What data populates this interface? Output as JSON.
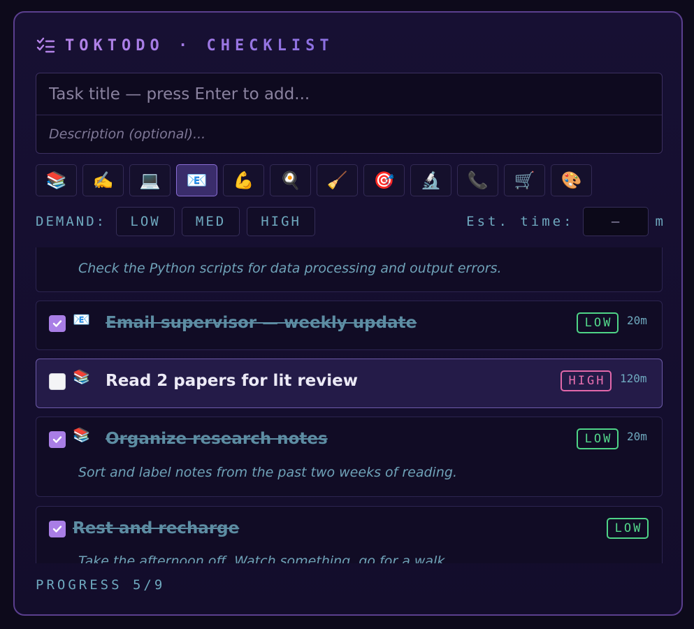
{
  "header": {
    "icon": "checklist-icon",
    "title": "TOKTODO · CHECKLIST"
  },
  "form": {
    "title_placeholder": "Task title — press Enter to add...",
    "description_placeholder": "Description (optional)...",
    "categories": [
      {
        "emoji": "📚",
        "name": "books"
      },
      {
        "emoji": "✍️",
        "name": "writing"
      },
      {
        "emoji": "💻",
        "name": "laptop"
      },
      {
        "emoji": "📧",
        "name": "email",
        "selected": true
      },
      {
        "emoji": "💪",
        "name": "exercise"
      },
      {
        "emoji": "🍳",
        "name": "cooking"
      },
      {
        "emoji": "🧹",
        "name": "cleaning"
      },
      {
        "emoji": "🎯",
        "name": "target"
      },
      {
        "emoji": "🔬",
        "name": "science"
      },
      {
        "emoji": "📞",
        "name": "phone"
      },
      {
        "emoji": "🛒",
        "name": "shopping"
      },
      {
        "emoji": "🎨",
        "name": "art"
      }
    ],
    "demand_label": "DEMAND:",
    "demand_options": [
      "LOW",
      "MED",
      "HIGH"
    ],
    "est_label": "Est. time:",
    "est_value": "—",
    "est_unit": "m"
  },
  "tasks": [
    {
      "name": "",
      "description": "Check the Python scripts for data processing and output errors.",
      "partial": true
    },
    {
      "name": "Email supervisor — weekly update",
      "emoji": "📧",
      "done": true,
      "demand": "LOW",
      "minutes": "20m"
    },
    {
      "name": "Read 2 papers for lit review",
      "emoji": "📚",
      "done": false,
      "demand": "HIGH",
      "minutes": "120m"
    },
    {
      "name": "Organize research notes",
      "emoji": "📚",
      "done": true,
      "demand": "LOW",
      "minutes": "20m",
      "description": "Sort and label notes from the past two weeks of reading."
    },
    {
      "name": "Rest and recharge",
      "done": true,
      "demand": "LOW",
      "description": "Take the afternoon off. Watch something, go for a walk."
    }
  ],
  "progress": {
    "label": "PROGRESS 5/9",
    "done": 5,
    "total": 9
  },
  "colors": {
    "accent": "#a97ee6",
    "low": "#53d88b",
    "high": "#e86fb0",
    "muted": "#6fa9bf"
  }
}
